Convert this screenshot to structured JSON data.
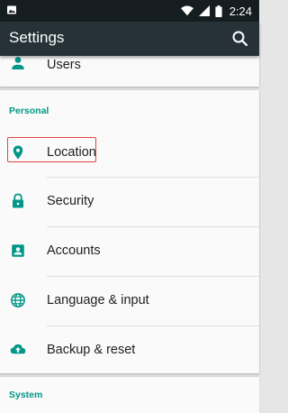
{
  "status_bar": {
    "time": "2:24",
    "left_icon": "image-icon",
    "right_icons": [
      "wifi-icon",
      "signal-icon",
      "battery-icon"
    ]
  },
  "app_bar": {
    "title": "Settings",
    "search_icon": "search-icon"
  },
  "colors": {
    "status_bar": "#161d20",
    "app_bar": "#263238",
    "accent": "#009688",
    "highlight": "#e0433f",
    "background": "#e6e6e6",
    "card": "#fafafa"
  },
  "top_item": {
    "label": "Users",
    "icon": "person-icon"
  },
  "personal": {
    "header": "Personal",
    "items": [
      {
        "label": "Location",
        "icon": "location-pin-icon",
        "highlighted": true
      },
      {
        "label": "Security",
        "icon": "lock-icon"
      },
      {
        "label": "Accounts",
        "icon": "account-box-icon"
      },
      {
        "label": "Language & input",
        "icon": "globe-icon"
      },
      {
        "label": "Backup & reset",
        "icon": "cloud-upload-icon"
      }
    ]
  },
  "system": {
    "header": "System"
  }
}
